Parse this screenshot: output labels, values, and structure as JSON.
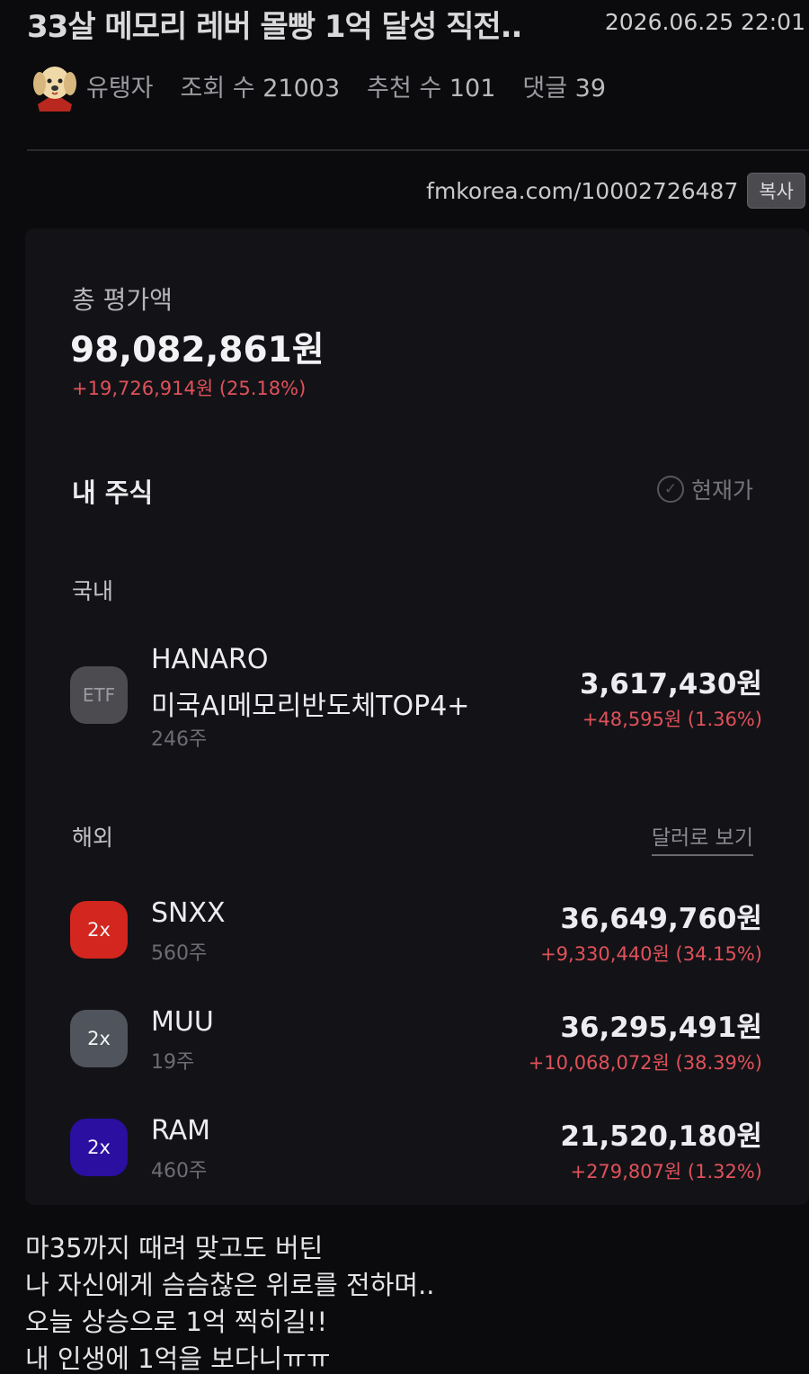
{
  "post": {
    "title": "33살 메모리 레버 몰빵 1억 달성 직전..",
    "date": "2026.06.25 22:01",
    "author": "유탱자",
    "views_label": "조회 수",
    "views": "21003",
    "likes_label": "추천 수",
    "likes": "101",
    "comments_label": "댓글",
    "comments": "39",
    "url": "fmkorea.com/10002726487",
    "copy_label": "복사",
    "body_lines": [
      "마35까지 때려 맞고도 버틴",
      "나 자신에게 슴슴찮은 위로를 전하며..",
      "오늘 상승으로 1억 찍히길!!",
      "내 인생에 1억을 보다니ㅠㅠ"
    ]
  },
  "portfolio": {
    "total_label": "총 평가액",
    "total_value": "98,082,861원",
    "total_gain": "+19,726,914원 (25.18%)",
    "section_title": "내 주식",
    "current_price_label": "현재가",
    "domestic_label": "국내",
    "overseas_label": "해외",
    "view_in_dollars": "달러로 보기",
    "domestic": [
      {
        "badge": "ETF",
        "name_line1": "HANARO",
        "name_line2": "미국AI메모리반도체TOP4+",
        "qty": "246주",
        "value": "3,617,430원",
        "gain": "+48,595원 (1.36%)"
      }
    ],
    "overseas": [
      {
        "badge": "2x",
        "name": "SNXX",
        "qty": "560주",
        "value": "36,649,760원",
        "gain": "+9,330,440원 (34.15%)"
      },
      {
        "badge": "2x",
        "name": "MUU",
        "qty": "19주",
        "value": "36,295,491원",
        "gain": "+10,068,072원 (38.39%)"
      },
      {
        "badge": "2x",
        "name": "RAM",
        "qty": "460주",
        "value": "21,520,180원",
        "gain": "+279,807원 (1.32%)"
      }
    ]
  },
  "colors": {
    "background": "#0b0b0d",
    "gain_red": "#e0515a",
    "badge_etf": "#4b4b50",
    "badge_snxx": "#d2261e",
    "badge_muu": "#50545c",
    "badge_ram": "#2a0fa0"
  },
  "icons": [
    "dog-avatar-icon",
    "check-circle-icon"
  ]
}
